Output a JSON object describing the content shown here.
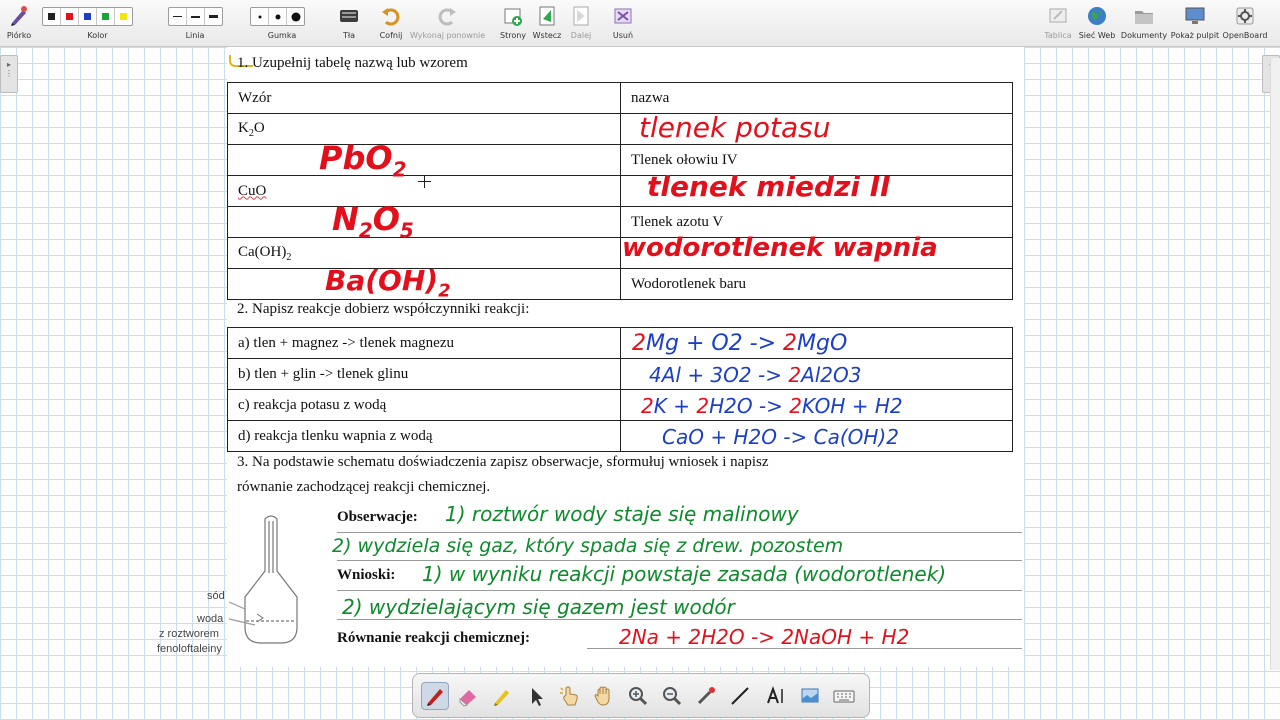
{
  "toolbar": {
    "pen_label": "Piórko",
    "color_label": "Kolor",
    "colors": [
      "#222222",
      "#e3101c",
      "#1b3fc6",
      "#1aa637",
      "#f2e60c"
    ],
    "line_label": "Linia",
    "eraser_label": "Gumka",
    "background_label": "Tła",
    "undo_label": "Cofnij",
    "redo_label": "Wykonaj ponownie",
    "pages_label": "Strony",
    "back_label": "Wstecz",
    "next_label": "Dalej",
    "delete_label": "Usuń",
    "board_label": "Tablica",
    "web_label": "Sieć Web",
    "documents_label": "Dokumenty",
    "desktop_label": "Pokaż pulpit",
    "openboard_label": "OpenBoard"
  },
  "worksheet": {
    "q1_title": "1. Uzupełnij tabelę nazwą lub wzorem",
    "table1": {
      "header": [
        "Wzór",
        "nazwa"
      ],
      "rows": [
        {
          "formula": "K2O",
          "name": "",
          "hw": "tlenek potasu"
        },
        {
          "formula": "",
          "name": "Tlenek ołowiu IV",
          "hw": "PbO2"
        },
        {
          "formula": "CuO",
          "name": "",
          "hw": "tlenek miedzi II"
        },
        {
          "formula": "",
          "name": "Tlenek azotu V",
          "hw": "N2O5"
        },
        {
          "formula": "Ca(OH)2",
          "name": "",
          "hw": "wodorotlenek wapnia"
        },
        {
          "formula": "",
          "name": "Wodorotlenek baru",
          "hw": "Ba(OH)2"
        }
      ]
    },
    "q2_title": "2. Napisz reakcje dobierz współczynniki reakcji:",
    "table2": [
      {
        "task": "a) tlen + magnez -> tlenek magnezu",
        "hw_coef": "2",
        "hw": "Mg + O2 -> ",
        "hw_coef2": "2",
        "hw2": "MgO"
      },
      {
        "task": "b) tlen + glin -> tlenek glinu",
        "hw": "4Al + 3O2 -> ",
        "hw_coef2": "2",
        "hw2": "Al2O3"
      },
      {
        "task": "c) reakcja potasu z wodą",
        "hw_coef": "2",
        "hw": "K + ",
        "hw_coef3": "2",
        "hw3": "H2O -> ",
        "hw_coef2": "2",
        "hw2": "KOH + H2"
      },
      {
        "task": "d) reakcja tlenku wapnia z wodą",
        "hw": "CaO + H2O -> Ca(OH)2"
      }
    ],
    "q3_line1": "3. Na podstawie schematu doświadczenia zapisz obserwacje, sformułuj wniosek i napisz",
    "q3_line2": "równanie zachodzącej reakcji chemicznej.",
    "observations_label": "Obserwacje:",
    "obs_1": "1) roztwór wody staje się malinowy",
    "obs_2": "2) wydziela się gaz, który spada się z drew. pozostem",
    "conclusions_label": "Wnioski:",
    "conc_1": "1) w wyniku reakcji powstaje zasada (wodorotlenek)",
    "conc_2": "2) wydzielającym się gazem jest wodór",
    "equation_label": "Równanie reakcji chemicznej:",
    "equation_hw": "2Na + 2H2O -> 2NaOH + H2",
    "figure": {
      "label_sod": "sód",
      "label_woda": "woda",
      "label_roztwor": "z roztworem",
      "label_fenol": "fenoloftaleiny"
    }
  },
  "bottom_tools": [
    "pen-tool",
    "eraser-tool",
    "marker-tool",
    "selector-tool",
    "play-tool",
    "hand-tool",
    "zoom-in-tool",
    "zoom-out-tool",
    "laser-pointer-tool",
    "line-tool",
    "text-tool",
    "capture-tool",
    "keyboard-tool"
  ]
}
